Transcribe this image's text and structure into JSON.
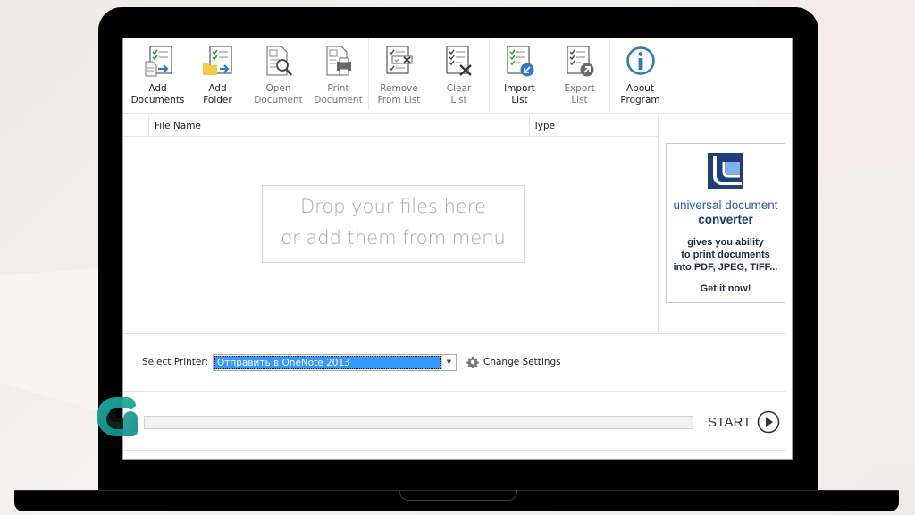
{
  "toolbar": {
    "groups": [
      [
        {
          "label": "Add\nDocuments",
          "icon": "add-documents-icon",
          "enabled": true
        },
        {
          "label": "Add\nFolder",
          "icon": "add-folder-icon",
          "enabled": true
        }
      ],
      [
        {
          "label": "Open\nDocument",
          "icon": "open-document-icon",
          "enabled": false
        },
        {
          "label": "Print\nDocument",
          "icon": "print-document-icon",
          "enabled": false
        }
      ],
      [
        {
          "label": "Remove\nFrom List",
          "icon": "remove-from-list-icon",
          "enabled": false
        },
        {
          "label": "Clear\nList",
          "icon": "clear-list-icon",
          "enabled": false
        }
      ],
      [
        {
          "label": "Import\nList",
          "icon": "import-list-icon",
          "enabled": true
        },
        {
          "label": "Export\nList",
          "icon": "export-list-icon",
          "enabled": false
        }
      ],
      [
        {
          "label": "About\nProgram",
          "icon": "info-icon",
          "enabled": true
        }
      ]
    ]
  },
  "table": {
    "columns": [
      "File Name",
      "Type"
    ],
    "rows": []
  },
  "drop_zone": {
    "line1": "Drop your files here",
    "line2": "or add them from menu"
  },
  "ad": {
    "title1": "universal document",
    "title2": "converter",
    "description": "gives you ability\nto print documents\ninto PDF, JPEG, TIFF...",
    "cta": "Get it now!"
  },
  "printer": {
    "label": "Select Printer:",
    "selected": "Отправить в OneNote 2013",
    "settings_label": "Change Settings"
  },
  "progress": {
    "value": 0
  },
  "start": {
    "label": "START"
  },
  "colors": {
    "accent": "#3399ff",
    "brand_blue": "#2a5ea8",
    "check_green": "#3a9a3a",
    "arrow_blue": "#2f78c4",
    "folder_yellow": "#f7c948",
    "watermark_teal": "#1aa9a0"
  }
}
